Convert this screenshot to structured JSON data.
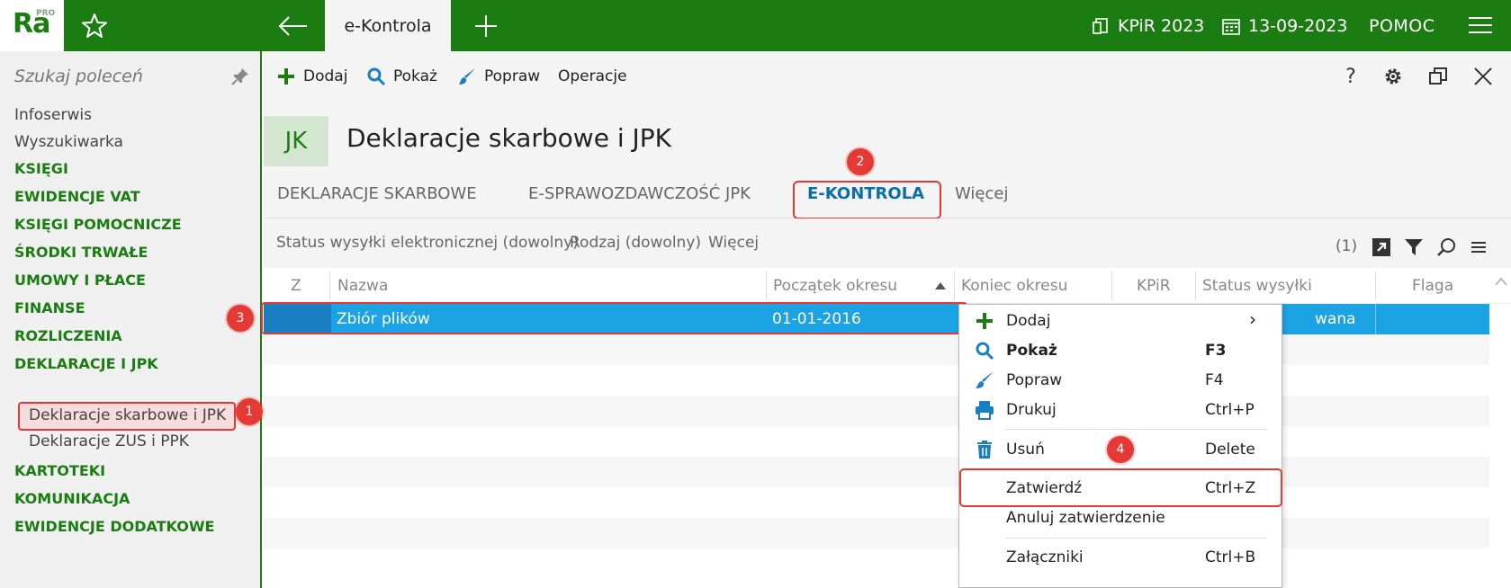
{
  "topbar": {
    "logo_text": "Ra",
    "logo_pro": "PRO",
    "active_tab": "e-Kontrola",
    "book": "KPiR 2023",
    "date": "13-09-2023",
    "help": "POMOC"
  },
  "sidebar": {
    "search_placeholder": "Szukaj poleceń",
    "items": [
      {
        "label": "Infoserwis",
        "kind": "plain"
      },
      {
        "label": "Wyszukiwarka",
        "kind": "plain"
      },
      {
        "label": "KSIĘGI",
        "kind": "section"
      },
      {
        "label": "EWIDENCJE VAT",
        "kind": "section"
      },
      {
        "label": "KSIĘGI POMOCNICZE",
        "kind": "section"
      },
      {
        "label": "ŚRODKI TRWAŁE",
        "kind": "section"
      },
      {
        "label": "UMOWY I PŁACE",
        "kind": "section"
      },
      {
        "label": "FINANSE",
        "kind": "section"
      },
      {
        "label": "ROZLICZENIA",
        "kind": "section"
      },
      {
        "label": "DEKLARACJE I JPK",
        "kind": "section"
      },
      {
        "label": "Deklaracje skarbowe i JPK",
        "kind": "sub-selected"
      },
      {
        "label": "Deklaracje ZUS i PPK",
        "kind": "sub"
      },
      {
        "label": "KARTOTEKI",
        "kind": "section"
      },
      {
        "label": "KOMUNIKACJA",
        "kind": "section"
      },
      {
        "label": "EWIDENCJE DODATKOWE",
        "kind": "section"
      }
    ]
  },
  "toolbar": {
    "add": "Dodaj",
    "show": "Pokaż",
    "edit": "Popraw",
    "operations": "Operacje",
    "help_icon": "?"
  },
  "page": {
    "badge": "JK",
    "title": "Deklaracje skarbowe i JPK"
  },
  "tabs": {
    "t1": "DEKLARACJE SKARBOWE",
    "t2": "E-SPRAWOZDAWCZOŚĆ JPK",
    "t3": "E-KONTROLA",
    "t4": "Więcej"
  },
  "filters": {
    "status": "Status wysyłki elektronicznej (dowolny)",
    "kind": "Rodzaj (dowolny)",
    "more": "Więcej",
    "count": "(1)"
  },
  "table": {
    "headers": {
      "z": "Z",
      "name": "Nazwa",
      "start": "Początek okresu",
      "end": "Koniec okresu",
      "kpir": "KPiR",
      "status": "Status wysyłki",
      "flag": "Flaga"
    },
    "row": {
      "name": "Zbiór plików",
      "start": "01-01-2016",
      "status_tail": "wana"
    }
  },
  "context_menu": {
    "add": "Dodaj",
    "add_arrow": "›",
    "show": "Pokaż",
    "show_key": "F3",
    "edit": "Popraw",
    "edit_key": "F4",
    "print": "Drukuj",
    "print_key": "Ctrl+P",
    "delete": "Usuń",
    "delete_key": "Delete",
    "approve": "Zatwierdź",
    "approve_key": "Ctrl+Z",
    "cancel_approve": "Anuluj zatwierdzenie",
    "attachments": "Załączniki",
    "attachments_key": "Ctrl+B"
  },
  "callouts": {
    "c1": "1",
    "c2": "2",
    "c3": "3",
    "c4": "4"
  },
  "colors": {
    "brand_green": "#1b7c12",
    "selected_row": "#1ca3e4",
    "callout_red": "#e53935",
    "active_tab_text": "#0b6fa4"
  }
}
